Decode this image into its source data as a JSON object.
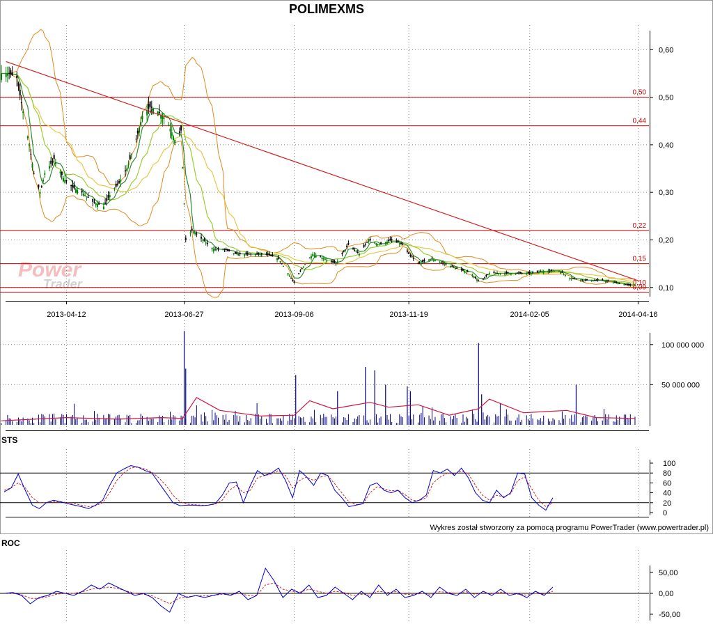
{
  "title": "POLIMEXMS",
  "watermark": {
    "line1": "Power",
    "line2": "Trader"
  },
  "credit": "Wykres został stworzony za pomocą programu PowerTrader (www.powertrader.pl)",
  "panels": {
    "sts_label": "STS",
    "roc_label": "ROC"
  },
  "colors": {
    "price_up": "#008000",
    "price_down": "#000000",
    "bollinger": "#e08a1e",
    "ma_short": "#2e8b2e",
    "ma_mid": "#9acd32",
    "ma_long": "#e6c84a",
    "trendline": "#d42020",
    "hline": "#c00000",
    "volume": "#000080",
    "volume_ma": "#d4143c",
    "sts_main": "#0000cc",
    "sts_signal": "#d42020",
    "roc_main": "#0000cc",
    "roc_signal": "#d42020",
    "grid": "#808080"
  },
  "chart_data": [
    {
      "type": "candlestick",
      "title": "POLIMEXMS",
      "x_ticks": [
        "2013-04-12",
        "2013-06-27",
        "2013-09-06",
        "2013-11-19",
        "2014-02-05",
        "2014-04-16"
      ],
      "y_ticks": [
        "0,60",
        "0,50",
        "0,40",
        "0,30",
        "0,20",
        "0,10"
      ],
      "ylim": [
        0.085,
        0.64
      ],
      "date_range": [
        "2013-03-01",
        "2014-04-23"
      ],
      "horizontal_lines": [
        {
          "value": 0.5,
          "label": "0,50"
        },
        {
          "value": 0.44,
          "label": "0,44"
        },
        {
          "value": 0.22,
          "label": "0,22"
        },
        {
          "value": 0.15,
          "label": "0,15"
        },
        {
          "value": 0.1,
          "label": "0,10"
        },
        {
          "value": 0.09,
          "label": "0,09"
        }
      ],
      "trendline": [
        {
          "date": "2013-03-04",
          "value": 0.575
        },
        {
          "date": "2014-04-14",
          "value": 0.112
        }
      ],
      "close_path": [
        {
          "date": "2013-03-01",
          "value": 0.55
        },
        {
          "date": "2013-03-06",
          "value": 0.55
        },
        {
          "date": "2013-03-11",
          "value": 0.54
        },
        {
          "date": "2013-03-15",
          "value": 0.47
        },
        {
          "date": "2013-03-19",
          "value": 0.4
        },
        {
          "date": "2013-03-22",
          "value": 0.34
        },
        {
          "date": "2013-03-26",
          "value": 0.3
        },
        {
          "date": "2013-03-29",
          "value": 0.34
        },
        {
          "date": "2013-04-04",
          "value": 0.37
        },
        {
          "date": "2013-04-10",
          "value": 0.33
        },
        {
          "date": "2013-04-16",
          "value": 0.31
        },
        {
          "date": "2013-04-22",
          "value": 0.3
        },
        {
          "date": "2013-04-29",
          "value": 0.28
        },
        {
          "date": "2013-05-06",
          "value": 0.27
        },
        {
          "date": "2013-05-11",
          "value": 0.3
        },
        {
          "date": "2013-05-16",
          "value": 0.32
        },
        {
          "date": "2013-05-21",
          "value": 0.35
        },
        {
          "date": "2013-05-26",
          "value": 0.4
        },
        {
          "date": "2013-05-31",
          "value": 0.46
        },
        {
          "date": "2013-06-05",
          "value": 0.48
        },
        {
          "date": "2013-06-10",
          "value": 0.47
        },
        {
          "date": "2013-06-16",
          "value": 0.45
        },
        {
          "date": "2013-06-21",
          "value": 0.41
        },
        {
          "date": "2013-06-25",
          "value": 0.43
        },
        {
          "date": "2013-06-28",
          "value": 0.2
        },
        {
          "date": "2013-07-02",
          "value": 0.22
        },
        {
          "date": "2013-07-09",
          "value": 0.2
        },
        {
          "date": "2013-07-16",
          "value": 0.18
        },
        {
          "date": "2013-07-23",
          "value": 0.18
        },
        {
          "date": "2013-07-31",
          "value": 0.17
        },
        {
          "date": "2013-08-09",
          "value": 0.17
        },
        {
          "date": "2013-08-19",
          "value": 0.17
        },
        {
          "date": "2013-08-27",
          "value": 0.16
        },
        {
          "date": "2013-09-02",
          "value": 0.13
        },
        {
          "date": "2013-09-06",
          "value": 0.11
        },
        {
          "date": "2013-09-11",
          "value": 0.14
        },
        {
          "date": "2013-09-18",
          "value": 0.17
        },
        {
          "date": "2013-09-26",
          "value": 0.16
        },
        {
          "date": "2013-10-03",
          "value": 0.15
        },
        {
          "date": "2013-10-11",
          "value": 0.19
        },
        {
          "date": "2013-10-18",
          "value": 0.17
        },
        {
          "date": "2013-10-24",
          "value": 0.2
        },
        {
          "date": "2013-10-31",
          "value": 0.19
        },
        {
          "date": "2013-11-08",
          "value": 0.2
        },
        {
          "date": "2013-11-15",
          "value": 0.19
        },
        {
          "date": "2013-11-19",
          "value": 0.17
        },
        {
          "date": "2013-11-25",
          "value": 0.15
        },
        {
          "date": "2013-12-03",
          "value": 0.16
        },
        {
          "date": "2013-12-12",
          "value": 0.15
        },
        {
          "date": "2013-12-20",
          "value": 0.14
        },
        {
          "date": "2013-12-29",
          "value": 0.13
        },
        {
          "date": "2014-01-04",
          "value": 0.11
        },
        {
          "date": "2014-01-10",
          "value": 0.13
        },
        {
          "date": "2014-01-18",
          "value": 0.13
        },
        {
          "date": "2014-01-26",
          "value": 0.13
        },
        {
          "date": "2014-02-05",
          "value": 0.13
        },
        {
          "date": "2014-02-15",
          "value": 0.135
        },
        {
          "date": "2014-02-24",
          "value": 0.135
        },
        {
          "date": "2014-03-03",
          "value": 0.12
        },
        {
          "date": "2014-03-13",
          "value": 0.115
        },
        {
          "date": "2014-03-23",
          "value": 0.115
        },
        {
          "date": "2014-04-02",
          "value": 0.11
        },
        {
          "date": "2014-04-10",
          "value": 0.105
        },
        {
          "date": "2014-04-14",
          "value": 0.105
        }
      ]
    },
    {
      "type": "bar",
      "title": "Volume",
      "y_ticks": [
        "100 000 000",
        "50 000 000"
      ],
      "ylim": [
        0,
        125000000
      ],
      "spikes": [
        {
          "date": "2013-06-27",
          "value": 117000000
        },
        {
          "date": "2013-06-28",
          "value": 70000000
        },
        {
          "date": "2013-09-07",
          "value": 62000000
        },
        {
          "date": "2013-10-04",
          "value": 42000000
        },
        {
          "date": "2013-10-22",
          "value": 72000000
        },
        {
          "date": "2013-10-28",
          "value": 68000000
        },
        {
          "date": "2013-11-04",
          "value": 50000000
        },
        {
          "date": "2013-11-18",
          "value": 48000000
        },
        {
          "date": "2013-11-20",
          "value": 42000000
        },
        {
          "date": "2014-01-03",
          "value": 102000000
        },
        {
          "date": "2014-01-05",
          "value": 38000000
        },
        {
          "date": "2014-03-07",
          "value": 50000000
        }
      ],
      "ma_path": [
        {
          "date": "2013-03-01",
          "value": 5000000
        },
        {
          "date": "2013-04-12",
          "value": 9000000
        },
        {
          "date": "2013-05-15",
          "value": 7000000
        },
        {
          "date": "2013-06-12",
          "value": 9000000
        },
        {
          "date": "2013-06-26",
          "value": 8000000
        },
        {
          "date": "2013-07-05",
          "value": 34000000
        },
        {
          "date": "2013-07-20",
          "value": 18000000
        },
        {
          "date": "2013-08-15",
          "value": 11000000
        },
        {
          "date": "2013-09-06",
          "value": 12000000
        },
        {
          "date": "2013-09-16",
          "value": 30000000
        },
        {
          "date": "2013-10-01",
          "value": 20000000
        },
        {
          "date": "2013-10-25",
          "value": 28000000
        },
        {
          "date": "2013-11-06",
          "value": 22000000
        },
        {
          "date": "2013-11-25",
          "value": 25000000
        },
        {
          "date": "2013-12-15",
          "value": 12000000
        },
        {
          "date": "2014-01-03",
          "value": 20000000
        },
        {
          "date": "2014-01-10",
          "value": 32000000
        },
        {
          "date": "2014-02-01",
          "value": 15000000
        },
        {
          "date": "2014-03-01",
          "value": 18000000
        },
        {
          "date": "2014-03-20",
          "value": 9000000
        },
        {
          "date": "2014-04-14",
          "value": 8000000
        }
      ]
    },
    {
      "type": "line",
      "title": "STS",
      "y_ticks": [
        "100",
        "80",
        "60",
        "40",
        "20",
        "0"
      ],
      "ylim": [
        0,
        100
      ],
      "reference_lines": [
        80,
        20
      ],
      "series": [
        {
          "values": [
            42,
            50,
            78,
            45,
            15,
            8,
            20,
            25,
            22,
            18,
            15,
            12,
            8,
            15,
            25,
            55,
            80,
            88,
            95,
            92,
            85,
            80,
            60,
            40,
            20,
            14,
            15,
            15,
            14,
            15,
            18,
            35,
            60,
            62,
            20,
            55,
            85,
            75,
            80,
            90,
            65,
            30,
            85,
            72,
            55,
            80,
            75,
            45,
            30,
            12,
            15,
            18,
            55,
            60,
            45,
            40,
            45,
            30,
            20,
            25,
            35,
            85,
            80,
            88,
            75,
            90,
            70,
            40,
            25,
            20,
            45,
            30,
            40,
            80,
            78,
            30,
            15,
            5,
            30
          ]
        },
        {
          "values": [
            45,
            50,
            60,
            50,
            30,
            20,
            20,
            22,
            22,
            20,
            18,
            15,
            12,
            14,
            20,
            40,
            65,
            80,
            90,
            92,
            88,
            82,
            70,
            55,
            35,
            22,
            17,
            16,
            15,
            15,
            17,
            25,
            45,
            55,
            40,
            45,
            70,
            75,
            78,
            85,
            75,
            50,
            65,
            72,
            65,
            72,
            75,
            58,
            40,
            22,
            16,
            17,
            40,
            52,
            48,
            44,
            45,
            36,
            25,
            24,
            30,
            60,
            72,
            80,
            78,
            84,
            78,
            55,
            35,
            25,
            35,
            32,
            38,
            65,
            72,
            48,
            25,
            12,
            20
          ]
        }
      ]
    },
    {
      "type": "line",
      "title": "ROC",
      "y_ticks": [
        "50,00",
        "0,00",
        "-50,00"
      ],
      "ylim": [
        -60,
        65
      ],
      "series": [
        {
          "values": [
            0,
            2,
            -5,
            -25,
            -10,
            -5,
            5,
            0,
            -5,
            5,
            20,
            10,
            25,
            15,
            5,
            -5,
            0,
            -10,
            -30,
            -45,
            0,
            -10,
            -5,
            -10,
            -5,
            0,
            -5,
            5,
            -15,
            -5,
            60,
            30,
            -10,
            10,
            0,
            20,
            -10,
            -5,
            15,
            0,
            -15,
            5,
            -10,
            20,
            -5,
            10,
            -10,
            -5,
            5,
            -10,
            15,
            0,
            -5,
            10,
            -10,
            5,
            -5,
            10,
            -5,
            0,
            -10,
            5,
            -5,
            15
          ]
        },
        {
          "values": [
            0,
            0,
            -3,
            -12,
            -12,
            -8,
            -2,
            0,
            0,
            4,
            10,
            12,
            15,
            12,
            6,
            0,
            -2,
            -6,
            -15,
            -25,
            -12,
            -8,
            -6,
            -6,
            -5,
            -2,
            -3,
            0,
            -5,
            -5,
            20,
            25,
            10,
            5,
            3,
            10,
            5,
            0,
            5,
            2,
            -5,
            -2,
            -4,
            5,
            2,
            4,
            -2,
            -3,
            0,
            -4,
            4,
            2,
            0,
            4,
            -2,
            1,
            -1,
            3,
            0,
            -2,
            -4,
            0,
            -2,
            5
          ]
        }
      ]
    }
  ]
}
